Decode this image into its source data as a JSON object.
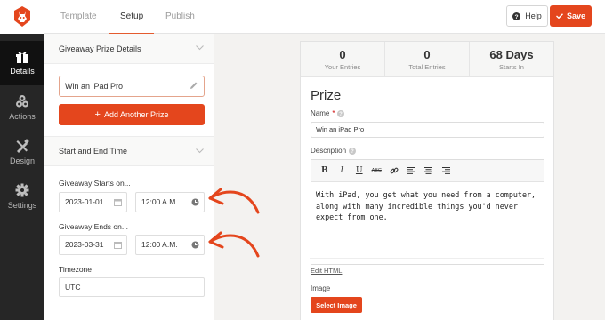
{
  "nav": {
    "items": [
      {
        "label": "Details",
        "icon": "gift-icon"
      },
      {
        "label": "Actions",
        "icon": "actions-icon"
      },
      {
        "label": "Design",
        "icon": "design-icon"
      },
      {
        "label": "Settings",
        "icon": "gear-icon"
      }
    ],
    "active": "Details"
  },
  "tabs": [
    {
      "label": "Template"
    },
    {
      "label": "Setup"
    },
    {
      "label": "Publish"
    }
  ],
  "active_tab": "Setup",
  "toolbar": {
    "help_label": "Help",
    "save_label": "Save"
  },
  "prize_section": {
    "title": "Giveaway Prize Details",
    "prize_value": "Win an iPad Pro",
    "add_label": "Add Another Prize"
  },
  "time_section": {
    "title": "Start and End Time",
    "starts_label": "Giveaway Starts on...",
    "start_date": "2023-01-01",
    "start_time": "12:00 A.M.",
    "ends_label": "Giveaway Ends on...",
    "end_date": "2023-03-31",
    "end_time": "12:00 A.M.",
    "timezone_label": "Timezone",
    "timezone_value": "UTC"
  },
  "preview": {
    "stats": [
      {
        "value": "0",
        "caption": "Your Entries"
      },
      {
        "value": "0",
        "caption": "Total Entries"
      },
      {
        "value": "68 Days",
        "caption": "Starts In"
      }
    ],
    "title": "Prize",
    "name_label": "Name",
    "name_required": "*",
    "name_value": "Win an iPad Pro",
    "description_label": "Description",
    "description_text": "With iPad, you get what you need from a computer, along with many incredible things you'd never expect from one.",
    "edit_html": "Edit HTML",
    "image_label": "Image",
    "select_image": "Select Image",
    "editor_tools": {
      "bold": "B",
      "italic": "I",
      "underline": "U",
      "strike": "ABC"
    }
  },
  "colors": {
    "accent": "#e4461d",
    "nav_bg": "#262626",
    "arrow": "#e4461d"
  }
}
